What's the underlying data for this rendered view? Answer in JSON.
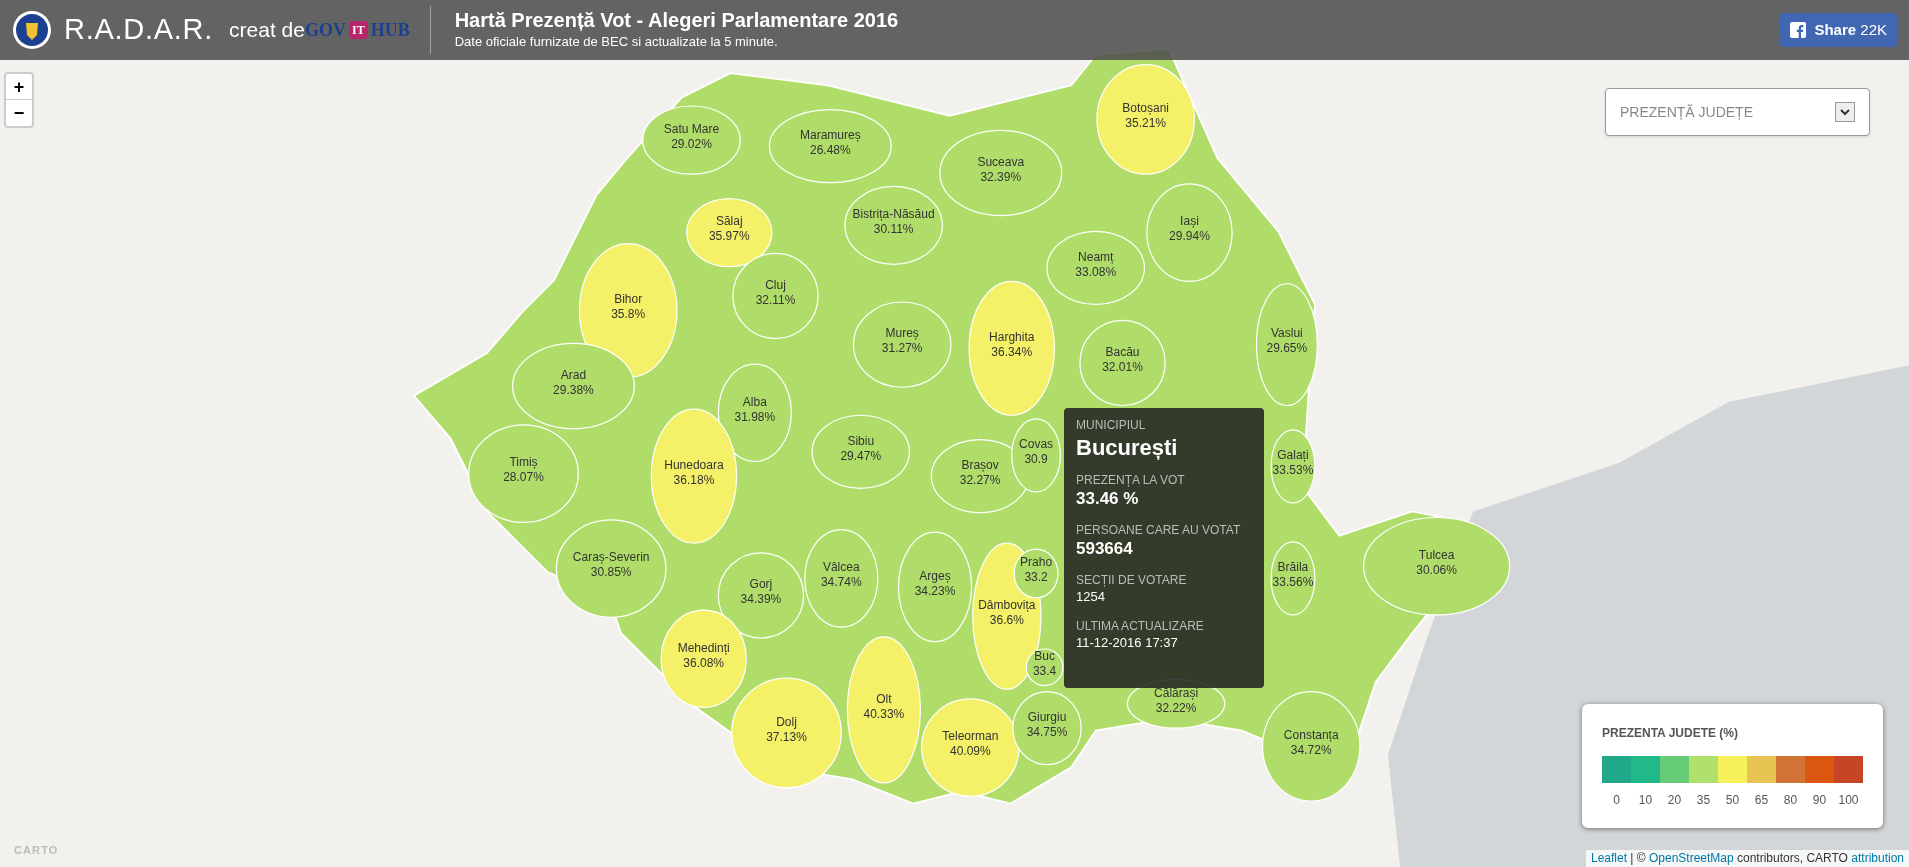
{
  "header": {
    "brand": "R.A.D.A.R.",
    "created_by": "creat de",
    "partner_logo": {
      "part_1": "GOV",
      "part_2": "IT",
      "part_3": "HUB"
    },
    "title": "Hartă Prezență Vot - Alegeri Parlamentare 2016",
    "subtitle": "Date oficiale furnizate de BEC si actualizate la 5 minute.",
    "share_button": {
      "label": "Share",
      "count": "22K"
    }
  },
  "zoom_controls": [
    "+",
    "−"
  ],
  "layer_select": {
    "value": "PREZENȚĂ JUDEȚE"
  },
  "counties": [
    {
      "name": "Satu Mare",
      "turnout": "29.02%",
      "color": "#b0dd6a"
    },
    {
      "name": "Maramureș",
      "turnout": "26.48%",
      "color": "#b0dd6a"
    },
    {
      "name": "Botoșani",
      "turnout": "35.21%",
      "color": "#f4f067"
    },
    {
      "name": "Suceava",
      "turnout": "32.39%",
      "color": "#b0dd6a"
    },
    {
      "name": "Sălaj",
      "turnout": "35.97%",
      "color": "#f4f067"
    },
    {
      "name": "Bistrița-Năsăud",
      "turnout": "30.11%",
      "color": "#b0dd6a"
    },
    {
      "name": "Iași",
      "turnout": "29.94%",
      "color": "#b0dd6a"
    },
    {
      "name": "Bihor",
      "turnout": "35.8%",
      "color": "#f4f067"
    },
    {
      "name": "Cluj",
      "turnout": "32.11%",
      "color": "#b0dd6a"
    },
    {
      "name": "Neamț",
      "turnout": "33.08%",
      "color": "#b0dd6a"
    },
    {
      "name": "Mureș",
      "turnout": "31.27%",
      "color": "#b0dd6a"
    },
    {
      "name": "Harghita",
      "turnout": "36.34%",
      "color": "#f4f067"
    },
    {
      "name": "Vaslui",
      "turnout": "29.65%",
      "color": "#b0dd6a"
    },
    {
      "name": "Bacău",
      "turnout": "32.01%",
      "color": "#b0dd6a"
    },
    {
      "name": "Arad",
      "turnout": "29.38%",
      "color": "#b0dd6a"
    },
    {
      "name": "Alba",
      "turnout": "31.98%",
      "color": "#b0dd6a"
    },
    {
      "name": "Timiș",
      "turnout": "28.07%",
      "color": "#b0dd6a"
    },
    {
      "name": "Hunedoara",
      "turnout": "36.18%",
      "color": "#f4f067"
    },
    {
      "name": "Sibiu",
      "turnout": "29.47%",
      "color": "#b0dd6a"
    },
    {
      "name": "Brașov",
      "turnout": "32.27%",
      "color": "#b0dd6a"
    },
    {
      "name": "Covas",
      "turnout": "30.9",
      "color": "#b0dd6a"
    },
    {
      "name": "Galați",
      "turnout": "33.53%",
      "color": "#b0dd6a"
    },
    {
      "name": "Caraș-Severin",
      "turnout": "30.85%",
      "color": "#b0dd6a"
    },
    {
      "name": "Gorj",
      "turnout": "34.39%",
      "color": "#b0dd6a"
    },
    {
      "name": "Vâlcea",
      "turnout": "34.74%",
      "color": "#b0dd6a"
    },
    {
      "name": "Argeș",
      "turnout": "34.23%",
      "color": "#b0dd6a"
    },
    {
      "name": "Dâmbovița",
      "turnout": "36.6%",
      "color": "#f4f067"
    },
    {
      "name": "Praho",
      "turnout": "33.2",
      "color": "#b0dd6a"
    },
    {
      "name": "Brăila",
      "turnout": "33.56%",
      "color": "#b0dd6a"
    },
    {
      "name": "Tulcea",
      "turnout": "30.06%",
      "color": "#b0dd6a"
    },
    {
      "name": "Mehedinți",
      "turnout": "36.08%",
      "color": "#f4f067"
    },
    {
      "name": "Olt",
      "turnout": "40.33%",
      "color": "#f4f067"
    },
    {
      "name": "Dolj",
      "turnout": "37.13%",
      "color": "#f4f067"
    },
    {
      "name": "Teleorman",
      "turnout": "40.09%",
      "color": "#f4f067"
    },
    {
      "name": "Buc",
      "turnout": "33.4",
      "color": "#b0dd6a"
    },
    {
      "name": "Giurgiu",
      "turnout": "34.75%",
      "color": "#b0dd6a"
    },
    {
      "name": "Călărași",
      "turnout": "32.22%",
      "color": "#b0dd6a"
    },
    {
      "name": "Constanța",
      "turnout": "34.72%",
      "color": "#b0dd6a"
    }
  ],
  "tooltip": {
    "type": "MUNICIPIUL",
    "name": "București",
    "fields": [
      {
        "label": "PREZENȚA LA VOT",
        "value": "33.46 %",
        "kind": "big"
      },
      {
        "label": "PERSOANE CARE AU VOTAT",
        "value": "593664",
        "kind": "big"
      },
      {
        "label": "SECȚII DE VOTARE",
        "value": "1254",
        "kind": "small"
      },
      {
        "label": "ULTIMA ACTUALIZARE",
        "value": "11-12-2016 17:37",
        "kind": "small"
      }
    ]
  },
  "legend": {
    "title": "PREZENTA JUDETE (%)",
    "steps": [
      {
        "label": "0",
        "color": "#1fa98a"
      },
      {
        "label": "10",
        "color": "#22b98a"
      },
      {
        "label": "20",
        "color": "#66cc77"
      },
      {
        "label": "35",
        "color": "#aee06b"
      },
      {
        "label": "50",
        "color": "#f5f05c"
      },
      {
        "label": "65",
        "color": "#e8c553"
      },
      {
        "label": "80",
        "color": "#d17334"
      },
      {
        "label": "90",
        "color": "#db5710"
      },
      {
        "label": "100",
        "color": "#c64527"
      }
    ]
  },
  "attribution": {
    "leaflet": "Leaflet",
    "separator": " | © ",
    "osm": "OpenStreetMap",
    "middle": " contributors, CARTO ",
    "link": "attribution"
  },
  "carto_logo": "CARTO"
}
